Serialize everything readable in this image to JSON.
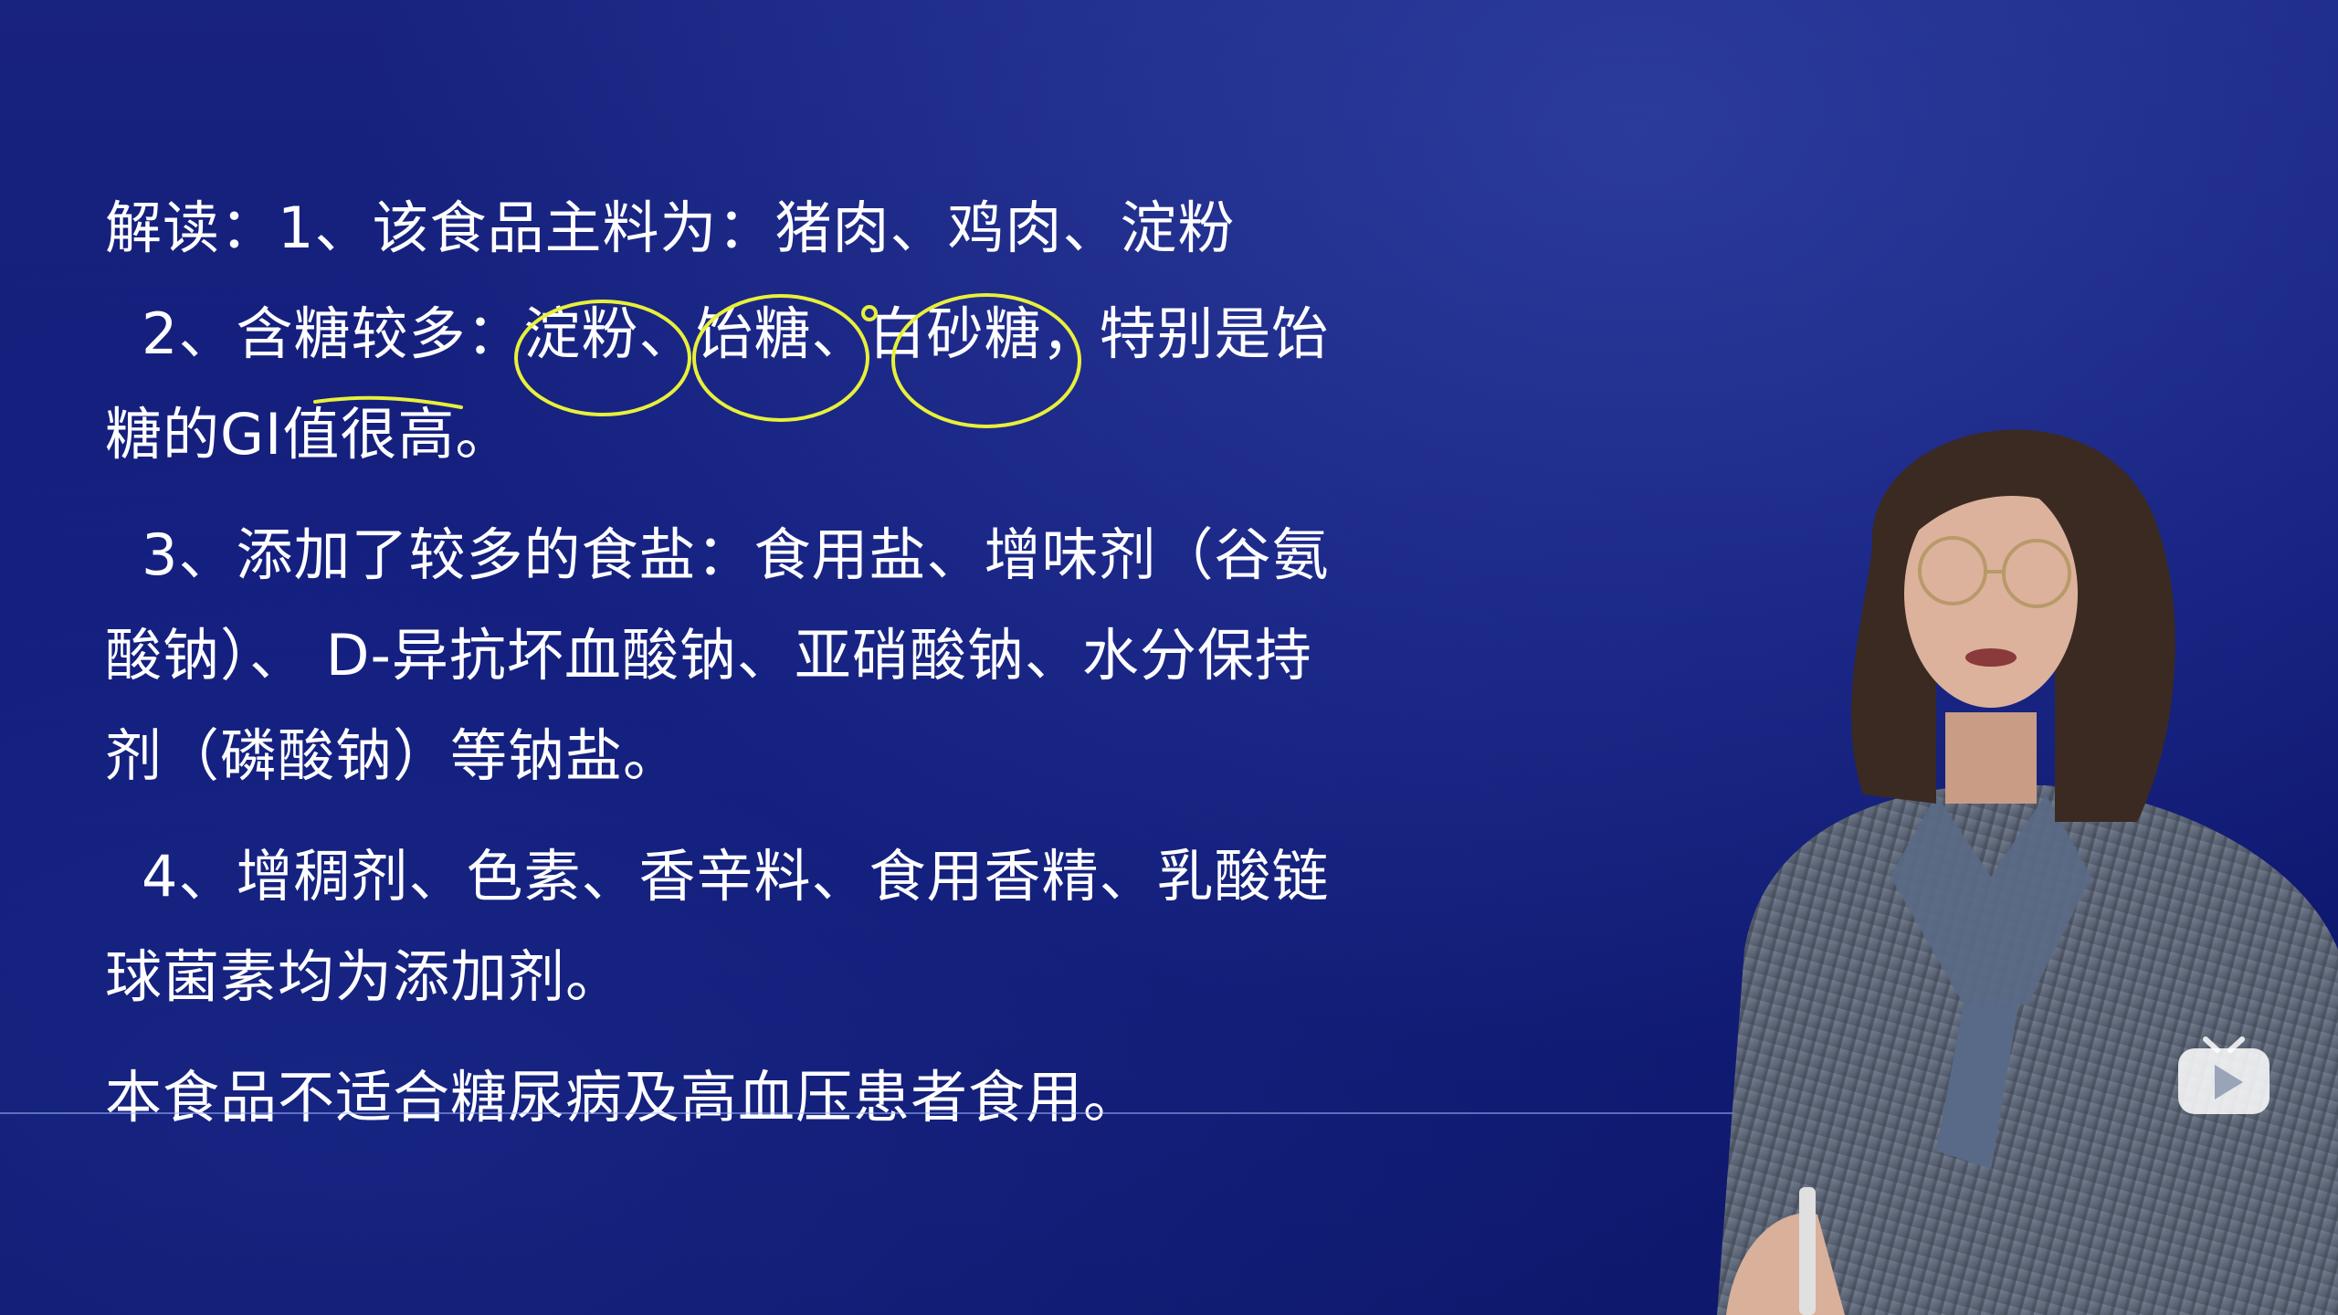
{
  "lecture": {
    "line1": "解读：1、该食品主料为：猪肉、鸡肉、淀粉",
    "line2_prefix": "2、含糖较多：",
    "line2_item1": "淀粉、",
    "line2_item2": "饴糖、",
    "line2_item3": "白砂糖",
    "line2_suffix": "，特别是饴",
    "line3": "糖的GI值很高。",
    "line4": "3、添加了较多的食盐：食用盐、增味剂（谷氨",
    "line5": "酸钠）、 D-异抗坏血酸钠、亚硝酸钠、水分保持",
    "line6": "剂（磷酸钠）等钠盐。",
    "line7": "4、增稠剂、色素、香辛料、食用香精、乳酸链",
    "line8": "球菌素均为添加剂。",
    "line9": "本食品不适合糖尿病及高血压患者食用。"
  },
  "colors": {
    "background": "#111b78",
    "text": "#ffffff",
    "annotation": "#e8f03a"
  },
  "icons": {
    "play_badge": "play-icon"
  }
}
